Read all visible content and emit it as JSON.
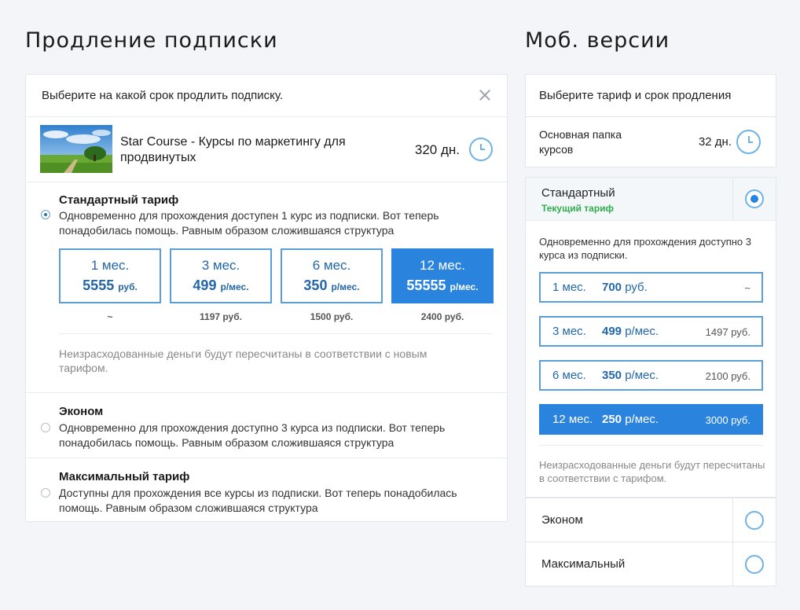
{
  "headings": {
    "desktop": "Продление подписки",
    "mobile": "Моб. версии"
  },
  "dialog": {
    "title": "Выберите на какой срок продлить подписку.",
    "course": {
      "name": "Star Course - Курсы по маркетингу для продвинутых",
      "days": "320 дн."
    },
    "tariffs": [
      {
        "name": "Стандартный тариф",
        "desc": "Одновременно для прохождения доступен 1 курс из подписки. Вот теперь понадобилась помощь. Равным образом сложившаяся структура",
        "selected": true
      },
      {
        "name": "Эконом",
        "desc": "Одновременно для прохождения доступно 3 курса из подписки. Вот теперь понадобилась помощь. Равным образом сложившаяся структура",
        "selected": false
      },
      {
        "name": "Максимальный тариф",
        "desc": "Доступны для прохождения все курсы из подписки. Вот теперь понадобилась помощь. Равным образом сложившаяся структура",
        "selected": false
      }
    ],
    "periods": [
      {
        "months": "1 мес.",
        "price": "5555",
        "unit": "руб.",
        "total": "~",
        "active": false
      },
      {
        "months": "3 мес.",
        "price": "499",
        "unit": "р/мес.",
        "total": "1197 руб.",
        "active": false
      },
      {
        "months": "6 мес.",
        "price": "350",
        "unit": "р/мес.",
        "total": "1500 руб.",
        "active": false
      },
      {
        "months": "12 мес.",
        "price": "55555",
        "unit": "р/мес.",
        "total": "2400 руб.",
        "active": true
      }
    ],
    "note": "Неизрасходованные деньги будут пересчитаны в соответствии с новым тарифом."
  },
  "mobile": {
    "title": "Выберите тариф и срок продления",
    "course": {
      "name": "Основная папка курсов",
      "days": "32 дн."
    },
    "standard": {
      "name": "Стандартный",
      "current": "Текущий тариф",
      "desc": "Одновременно для прохождения доступно 3 курса из подписки."
    },
    "periods": [
      {
        "months": "1 мес.",
        "price": "700",
        "unit": "руб.",
        "total": "~",
        "active": false
      },
      {
        "months": "3 мес.",
        "price": "499",
        "unit": "р/мес.",
        "total": "1497 руб.",
        "active": false
      },
      {
        "months": "6 мес.",
        "price": "350",
        "unit": "р/мес.",
        "total": "2100 руб.",
        "active": false
      },
      {
        "months": "12 мес.",
        "price": "250",
        "unit": "р/мес.",
        "total": "3000 руб.",
        "active": true
      }
    ],
    "note": "Неизрасходованные деньги будут пересчитаны в соответствии с тарифом.",
    "options": [
      {
        "name": "Эконом"
      },
      {
        "name": "Максимальный"
      }
    ]
  },
  "colors": {
    "accent": "#2a84de",
    "accent_text": "#2367a8",
    "current_tariff": "#2fae4d"
  }
}
